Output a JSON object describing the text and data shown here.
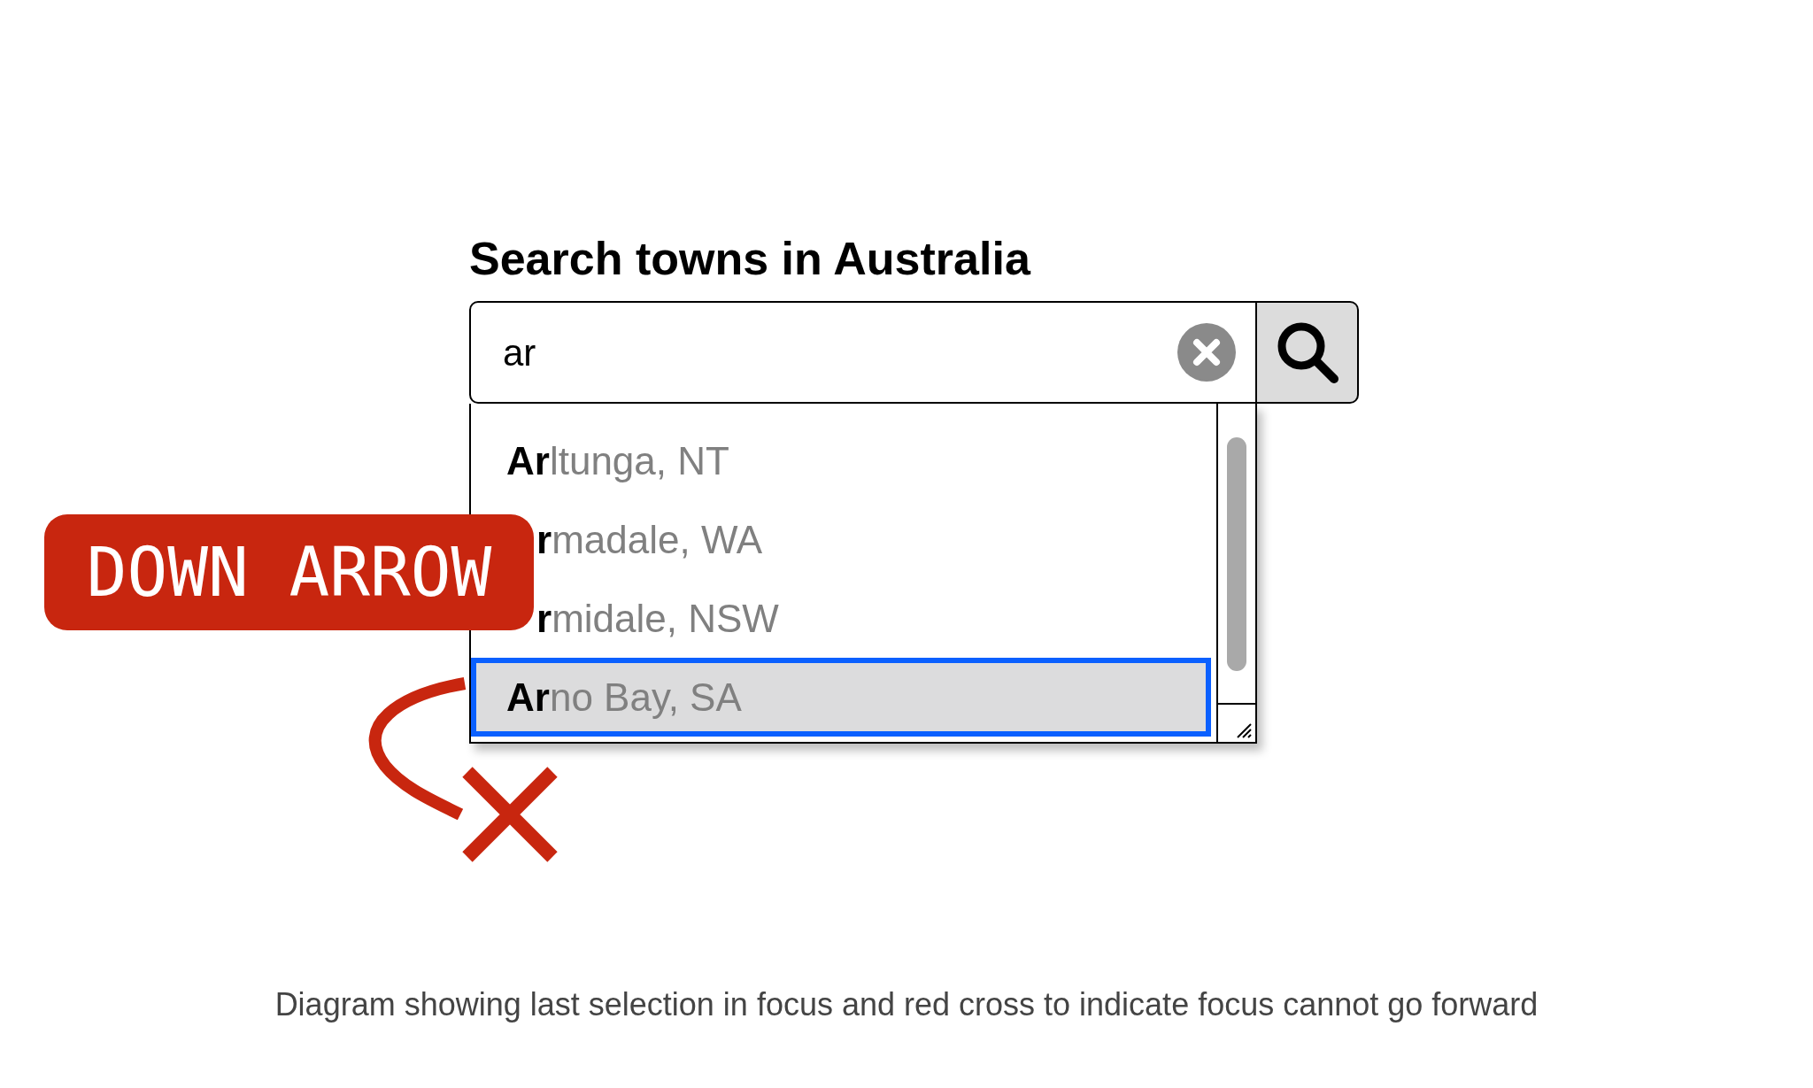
{
  "heading": "Search towns in Australia",
  "search": {
    "value": "ar"
  },
  "suggestions": [
    {
      "text": "**Ar**ltunga, NT",
      "selected": false
    },
    {
      "text": "**r**madale, WA",
      "selected": false
    },
    {
      "text": "**r**midale, NSW",
      "selected": false
    },
    {
      "text": "**Ar**no Bay, SA",
      "selected": true
    }
  ],
  "key_label": "DOWN ARROW",
  "caption": "Diagram showing last selection in focus and red cross to indicate focus cannot go forward"
}
